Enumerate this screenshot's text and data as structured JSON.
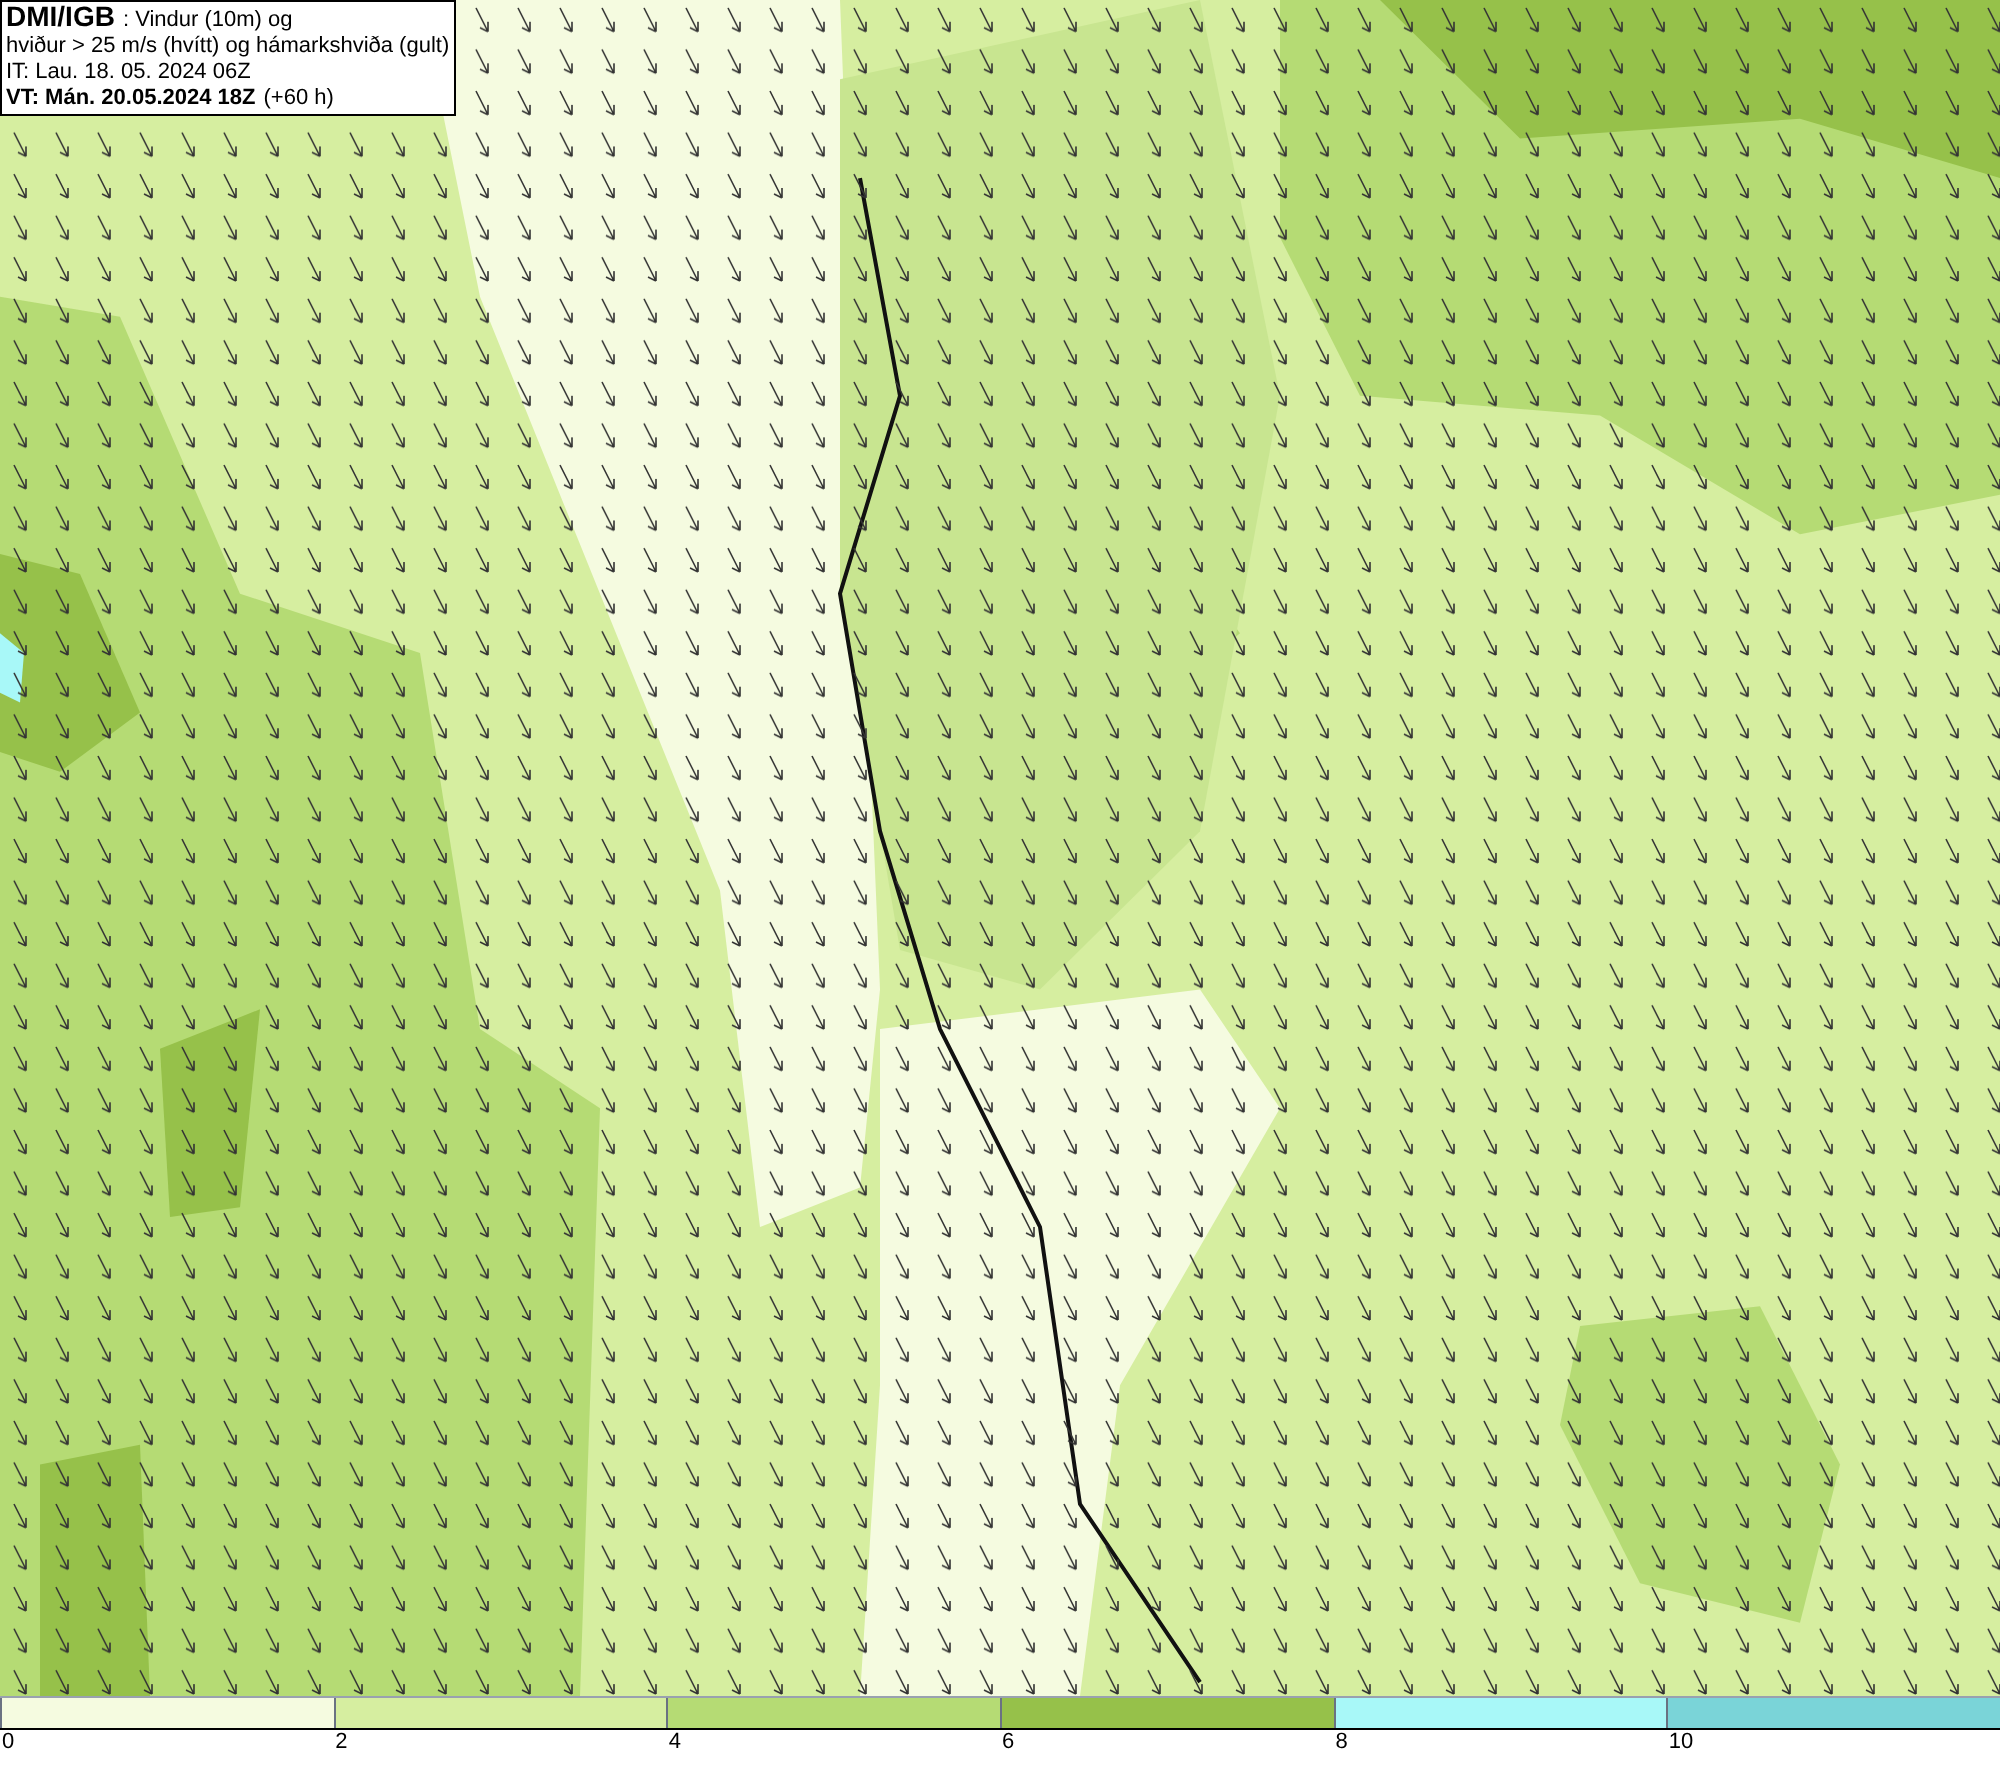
{
  "title_box": {
    "source": "DMI/IGB",
    "description": ": Vindur (10m) og",
    "line_2": "hviður > 25 m/s (hvítt) og hámarkshviða (gult)",
    "issue_time": "IT: Lau. 18. 05. 2024 06Z",
    "valid_time": "VT: Mán. 20.05.2024 18Z",
    "lead_time": "(+60 h)"
  },
  "legend": [
    {
      "label": "0",
      "color": "#f5fbe0"
    },
    {
      "label": "2",
      "color": "#d6eea0"
    },
    {
      "label": "4",
      "color": "#b5db74"
    },
    {
      "label": "6",
      "color": "#96c14a"
    },
    {
      "label": "8",
      "color": "#a8f8f8"
    },
    {
      "label": "10",
      "color": "#7ad4d8"
    }
  ]
}
